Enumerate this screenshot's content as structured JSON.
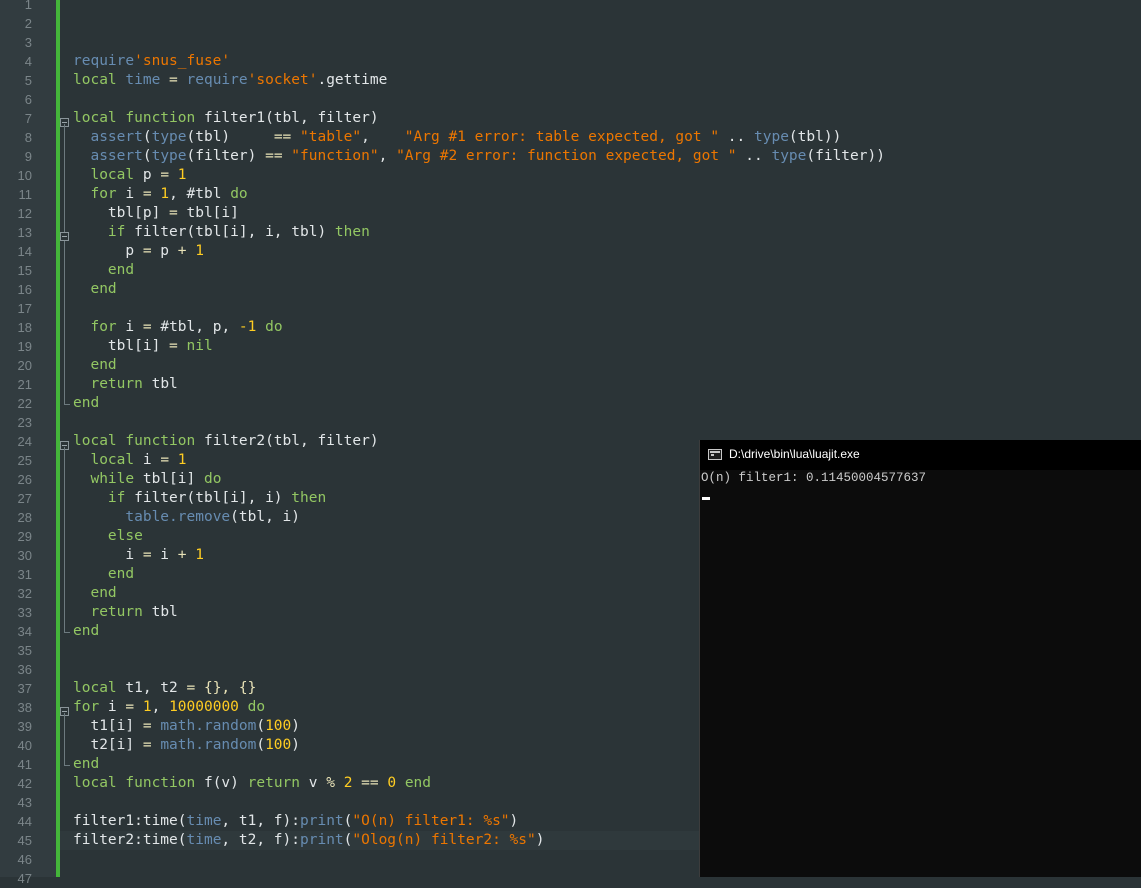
{
  "editor": {
    "line_numbers": [
      "1",
      "2",
      "3",
      "4",
      "5",
      "6",
      "7",
      "8",
      "9",
      "10",
      "11",
      "12",
      "13",
      "14",
      "15",
      "16",
      "17",
      "18",
      "19",
      "20",
      "21",
      "22",
      "23",
      "24",
      "25",
      "26",
      "27",
      "28",
      "29",
      "30",
      "31",
      "32",
      "33",
      "34",
      "35",
      "36",
      "37",
      "38",
      "39",
      "40",
      "41",
      "42",
      "43",
      "44",
      "45",
      "46",
      "47"
    ],
    "lines": [
      [],
      [],
      [],
      [
        [
          "fn",
          "require"
        ],
        [
          "str",
          "'snus_fuse'"
        ]
      ],
      [
        [
          "kw",
          "local"
        ],
        [
          "tx",
          " "
        ],
        [
          "fn",
          "time"
        ],
        [
          "tx",
          " "
        ],
        [
          "op",
          "="
        ],
        [
          "tx",
          " "
        ],
        [
          "fn",
          "require"
        ],
        [
          "str",
          "'socket'"
        ],
        [
          "tx",
          ".gettime"
        ]
      ],
      [],
      [
        [
          "kw",
          "local"
        ],
        [
          "tx",
          " "
        ],
        [
          "kw",
          "function"
        ],
        [
          "tx",
          " filter1(tbl, filter)"
        ]
      ],
      [
        [
          "tx",
          "  "
        ],
        [
          "fn",
          "assert"
        ],
        [
          "tx",
          "("
        ],
        [
          "fn",
          "type"
        ],
        [
          "tx",
          "(tbl)     "
        ],
        [
          "op",
          "=="
        ],
        [
          "tx",
          " "
        ],
        [
          "str",
          "\"table\""
        ],
        [
          "tx",
          ",    "
        ],
        [
          "str",
          "\"Arg #1 error: table expected, got \""
        ],
        [
          "tx",
          " .. "
        ],
        [
          "fn",
          "type"
        ],
        [
          "tx",
          "(tbl))"
        ]
      ],
      [
        [
          "tx",
          "  "
        ],
        [
          "fn",
          "assert"
        ],
        [
          "tx",
          "("
        ],
        [
          "fn",
          "type"
        ],
        [
          "tx",
          "(filter) "
        ],
        [
          "op",
          "=="
        ],
        [
          "tx",
          " "
        ],
        [
          "str",
          "\"function\""
        ],
        [
          "tx",
          ", "
        ],
        [
          "str",
          "\"Arg #2 error: function expected, got \""
        ],
        [
          "tx",
          " .. "
        ],
        [
          "fn",
          "type"
        ],
        [
          "tx",
          "(filter))"
        ]
      ],
      [
        [
          "tx",
          "  "
        ],
        [
          "kw",
          "local"
        ],
        [
          "tx",
          " p "
        ],
        [
          "op",
          "="
        ],
        [
          "tx",
          " "
        ],
        [
          "num",
          "1"
        ]
      ],
      [
        [
          "tx",
          "  "
        ],
        [
          "kw",
          "for"
        ],
        [
          "tx",
          " i "
        ],
        [
          "op",
          "="
        ],
        [
          "tx",
          " "
        ],
        [
          "num",
          "1"
        ],
        [
          "tx",
          ", #tbl "
        ],
        [
          "kw",
          "do"
        ]
      ],
      [
        [
          "tx",
          "    tbl[p] "
        ],
        [
          "op",
          "="
        ],
        [
          "tx",
          " tbl[i]"
        ]
      ],
      [
        [
          "tx",
          "    "
        ],
        [
          "kw",
          "if"
        ],
        [
          "tx",
          " filter(tbl[i], i, tbl) "
        ],
        [
          "kw",
          "then"
        ]
      ],
      [
        [
          "tx",
          "      p "
        ],
        [
          "op",
          "="
        ],
        [
          "tx",
          " p "
        ],
        [
          "op",
          "+"
        ],
        [
          "tx",
          " "
        ],
        [
          "num",
          "1"
        ]
      ],
      [
        [
          "tx",
          "    "
        ],
        [
          "kw",
          "end"
        ]
      ],
      [
        [
          "tx",
          "  "
        ],
        [
          "kw",
          "end"
        ]
      ],
      [],
      [
        [
          "tx",
          "  "
        ],
        [
          "kw",
          "for"
        ],
        [
          "tx",
          " i "
        ],
        [
          "op",
          "="
        ],
        [
          "tx",
          " #tbl, p, "
        ],
        [
          "num",
          "-1"
        ],
        [
          "tx",
          " "
        ],
        [
          "kw",
          "do"
        ]
      ],
      [
        [
          "tx",
          "    tbl[i] "
        ],
        [
          "op",
          "="
        ],
        [
          "tx",
          " "
        ],
        [
          "kw",
          "nil"
        ]
      ],
      [
        [
          "tx",
          "  "
        ],
        [
          "kw",
          "end"
        ]
      ],
      [
        [
          "tx",
          "  "
        ],
        [
          "kw",
          "return"
        ],
        [
          "tx",
          " tbl"
        ]
      ],
      [
        [
          "kw",
          "end"
        ]
      ],
      [],
      [
        [
          "kw",
          "local"
        ],
        [
          "tx",
          " "
        ],
        [
          "kw",
          "function"
        ],
        [
          "tx",
          " filter2(tbl, filter)"
        ]
      ],
      [
        [
          "tx",
          "  "
        ],
        [
          "kw",
          "local"
        ],
        [
          "tx",
          " i "
        ],
        [
          "op",
          "="
        ],
        [
          "tx",
          " "
        ],
        [
          "num",
          "1"
        ]
      ],
      [
        [
          "tx",
          "  "
        ],
        [
          "kw",
          "while"
        ],
        [
          "tx",
          " tbl[i] "
        ],
        [
          "kw",
          "do"
        ]
      ],
      [
        [
          "tx",
          "    "
        ],
        [
          "kw",
          "if"
        ],
        [
          "tx",
          " filter(tbl[i], i) "
        ],
        [
          "kw",
          "then"
        ]
      ],
      [
        [
          "tx",
          "      "
        ],
        [
          "fn",
          "table.remove"
        ],
        [
          "tx",
          "(tbl, i)"
        ]
      ],
      [
        [
          "tx",
          "    "
        ],
        [
          "kw",
          "else"
        ]
      ],
      [
        [
          "tx",
          "      i "
        ],
        [
          "op",
          "="
        ],
        [
          "tx",
          " i "
        ],
        [
          "op",
          "+"
        ],
        [
          "tx",
          " "
        ],
        [
          "num",
          "1"
        ]
      ],
      [
        [
          "tx",
          "    "
        ],
        [
          "kw",
          "end"
        ]
      ],
      [
        [
          "tx",
          "  "
        ],
        [
          "kw",
          "end"
        ]
      ],
      [
        [
          "tx",
          "  "
        ],
        [
          "kw",
          "return"
        ],
        [
          "tx",
          " tbl"
        ]
      ],
      [
        [
          "kw",
          "end"
        ]
      ],
      [],
      [],
      [
        [
          "kw",
          "local"
        ],
        [
          "tx",
          " t1, t2 "
        ],
        [
          "op",
          "="
        ],
        [
          "tx",
          " "
        ],
        [
          "op",
          "{}, {}"
        ]
      ],
      [
        [
          "kw",
          "for"
        ],
        [
          "tx",
          " i "
        ],
        [
          "op",
          "="
        ],
        [
          "tx",
          " "
        ],
        [
          "num",
          "1"
        ],
        [
          "tx",
          ", "
        ],
        [
          "num",
          "10000000"
        ],
        [
          "tx",
          " "
        ],
        [
          "kw",
          "do"
        ]
      ],
      [
        [
          "tx",
          "  t1[i] "
        ],
        [
          "op",
          "="
        ],
        [
          "tx",
          " "
        ],
        [
          "fn",
          "math.random"
        ],
        [
          "tx",
          "("
        ],
        [
          "num",
          "100"
        ],
        [
          "tx",
          ")"
        ]
      ],
      [
        [
          "tx",
          "  t2[i] "
        ],
        [
          "op",
          "="
        ],
        [
          "tx",
          " "
        ],
        [
          "fn",
          "math.random"
        ],
        [
          "tx",
          "("
        ],
        [
          "num",
          "100"
        ],
        [
          "tx",
          ")"
        ]
      ],
      [
        [
          "kw",
          "end"
        ]
      ],
      [
        [
          "kw",
          "local"
        ],
        [
          "tx",
          " "
        ],
        [
          "kw",
          "function"
        ],
        [
          "tx",
          " f(v) "
        ],
        [
          "kw",
          "return"
        ],
        [
          "tx",
          " v "
        ],
        [
          "op",
          "%"
        ],
        [
          "tx",
          " "
        ],
        [
          "num",
          "2"
        ],
        [
          "tx",
          " "
        ],
        [
          "op",
          "=="
        ],
        [
          "tx",
          " "
        ],
        [
          "num",
          "0"
        ],
        [
          "tx",
          " "
        ],
        [
          "kw",
          "end"
        ]
      ],
      [],
      [
        [
          "tx",
          "filter1:time("
        ],
        [
          "fn",
          "time"
        ],
        [
          "tx",
          ", t1, f):"
        ],
        [
          "fn",
          "print"
        ],
        [
          "tx",
          "("
        ],
        [
          "str",
          "\"O(n) filter1: %s\""
        ],
        [
          "tx",
          ")"
        ]
      ],
      [
        [
          "tx",
          "filter2:time("
        ],
        [
          "fn",
          "time"
        ],
        [
          "tx",
          ", t2, f):"
        ],
        [
          "fn",
          "print"
        ],
        [
          "tx",
          "("
        ],
        [
          "str",
          "\"Olog(n) filter2: %s\""
        ],
        [
          "tx",
          ")"
        ]
      ],
      [],
      []
    ],
    "colors": {
      "background": "#2b3437",
      "keyword": "#93c763",
      "builtin": "#678cb1",
      "string": "#ec7600",
      "number": "#ffcd22",
      "operator": "#e8e2b7",
      "modified_marker": "#44b53a"
    }
  },
  "console": {
    "title": "D:\\drive\\bin\\lua\\luajit.exe",
    "output": "O(n) filter1: 0.11450004577637",
    "background": "#0c0c0c"
  }
}
